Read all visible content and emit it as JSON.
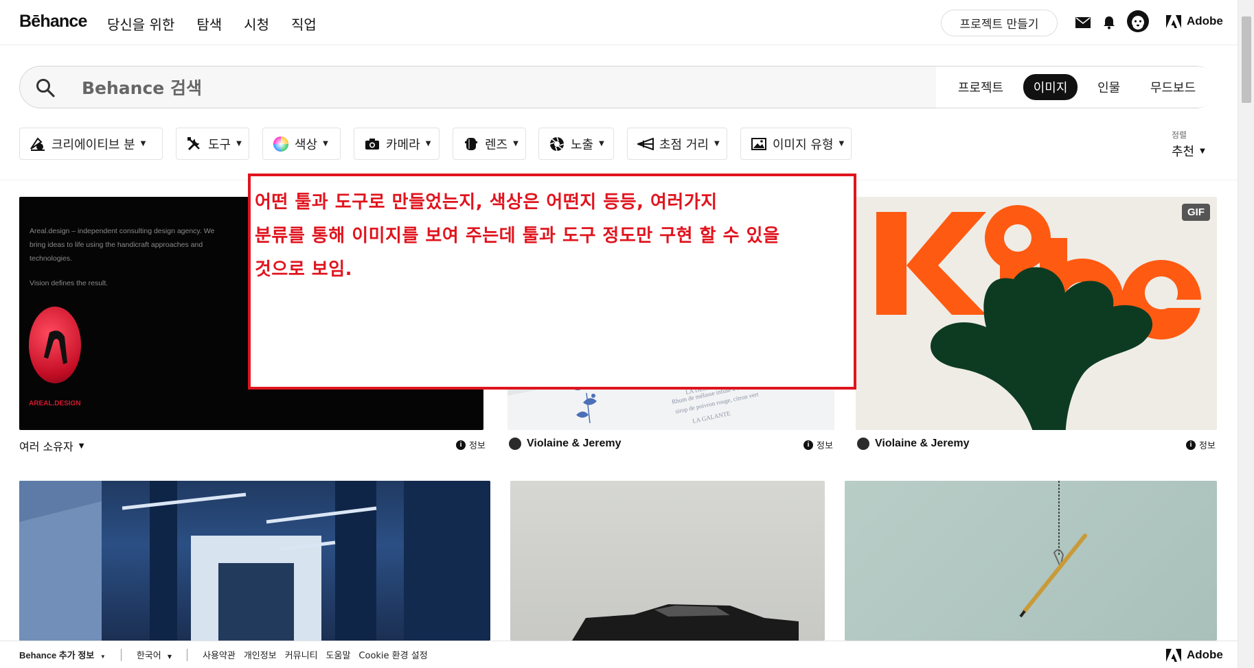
{
  "nav": {
    "logo": "Bēhance",
    "links": [
      "당신을 위한",
      "탐색",
      "시청",
      "직업"
    ],
    "create_button": "프로젝트 만들기",
    "brand": "Adobe"
  },
  "search": {
    "placeholder": "Behance 검색",
    "tabs": [
      "프로젝트",
      "이미지",
      "인물",
      "무드보드"
    ],
    "active_tab": "이미지"
  },
  "filters": {
    "items": [
      {
        "label": "크리에이티브 분",
        "icon": "creative-field-icon"
      },
      {
        "label": "도구",
        "icon": "tools-icon"
      },
      {
        "label": "색상",
        "icon": "color-wheel-icon"
      },
      {
        "label": "카메라",
        "icon": "camera-icon"
      },
      {
        "label": "렌즈",
        "icon": "lens-icon"
      },
      {
        "label": "노출",
        "icon": "aperture-icon"
      },
      {
        "label": "초점 거리",
        "icon": "focal-length-icon"
      },
      {
        "label": "이미지 유형",
        "icon": "image-type-icon"
      }
    ],
    "sort_label": "정렬",
    "sort_value": "추천"
  },
  "cards": [
    {
      "owner": "여러 소유자",
      "info": "정보",
      "img_text": {
        "line1": "Areal.design – independent consulting design agency. We",
        "line2": "bring ideas to life using the handicraft approaches and",
        "line3": "technologies.",
        "line4": "Vision defines the result.",
        "brand": "AREAL.DESIGN"
      }
    },
    {
      "owner": "Violaine & Jeremy",
      "info": "정보"
    },
    {
      "owner": "Violaine & Jeremy",
      "info": "정보",
      "badge": "GIF",
      "title": "Kobe"
    }
  ],
  "annotation": {
    "text": "어떤 툴과 도구로 만들었는지, 색상은 어떤지 등등, 여러가지\n분류를 통해 이미지를 보여 주는데 툴과 도구 정도만 구현 할 수 있을\n것으로 보임.",
    "color": "#e0141e"
  },
  "footer": {
    "more": "Behance 추가 정보",
    "language": "한국어",
    "links": [
      "사용약관",
      "개인정보",
      "커뮤니티",
      "도움말",
      "Cookie 환경 설정"
    ],
    "brand": "Adobe"
  }
}
